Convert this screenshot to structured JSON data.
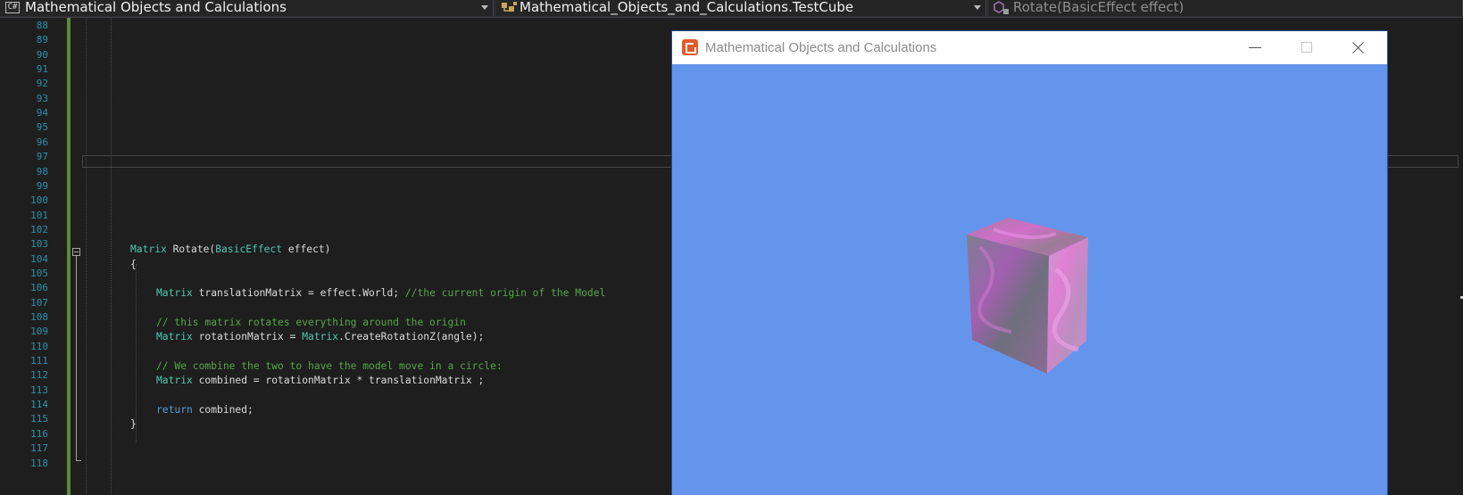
{
  "navbar": {
    "project": {
      "icon": "C#",
      "label": "Mathematical Objects and Calculations"
    },
    "class": {
      "icon": "class-icon",
      "label": "Mathematical_Objects_and_Calculations.TestCube"
    },
    "member": {
      "icon": "method-icon",
      "label": "Rotate(BasicEffect effect)"
    }
  },
  "editor": {
    "line_numbers": [
      "88",
      "89",
      "90",
      "91",
      "92",
      "93",
      "94",
      "95",
      "96",
      "97",
      "98",
      "99",
      "100",
      "101",
      "102",
      "103",
      "104",
      "105",
      "106",
      "107",
      "108",
      "109",
      "110",
      "111",
      "112",
      "113",
      "114",
      "115",
      "116",
      "117",
      "118"
    ],
    "code": {
      "l103_type": "Matrix",
      "l103_name": " Rotate(",
      "l103_param_type": "BasicEffect",
      "l103_param": " effect)",
      "l104": "{",
      "l106_type": "Matrix",
      "l106_code": " translationMatrix = effect.World; ",
      "l106_comment": "//the current origin of the Model",
      "l108_comment": "// this matrix rotates everything around the origin",
      "l109_type": "Matrix",
      "l109_mid": " rotationMatrix = ",
      "l109_type2": "Matrix",
      "l109_end": ".CreateRotationZ(angle);",
      "l111_comment": "// We combine the two to have the model move in a circle:",
      "l112_type": "Matrix",
      "l112_code": " combined = rotationMatrix * translationMatrix ;",
      "l114_kw": "return",
      "l114_code": " combined;",
      "l115": "}"
    }
  },
  "game_window": {
    "title": "Mathematical Objects and Calculations",
    "background_color": "#6495ed",
    "logo": "monogame-logo-icon"
  },
  "colors": {
    "editor_bg": "#1e1e1e",
    "type": "#4ec9b0",
    "keyword": "#569cd6",
    "comment": "#57a64a",
    "line_number": "#2b91af",
    "change_bar": "#5b8a3a"
  }
}
